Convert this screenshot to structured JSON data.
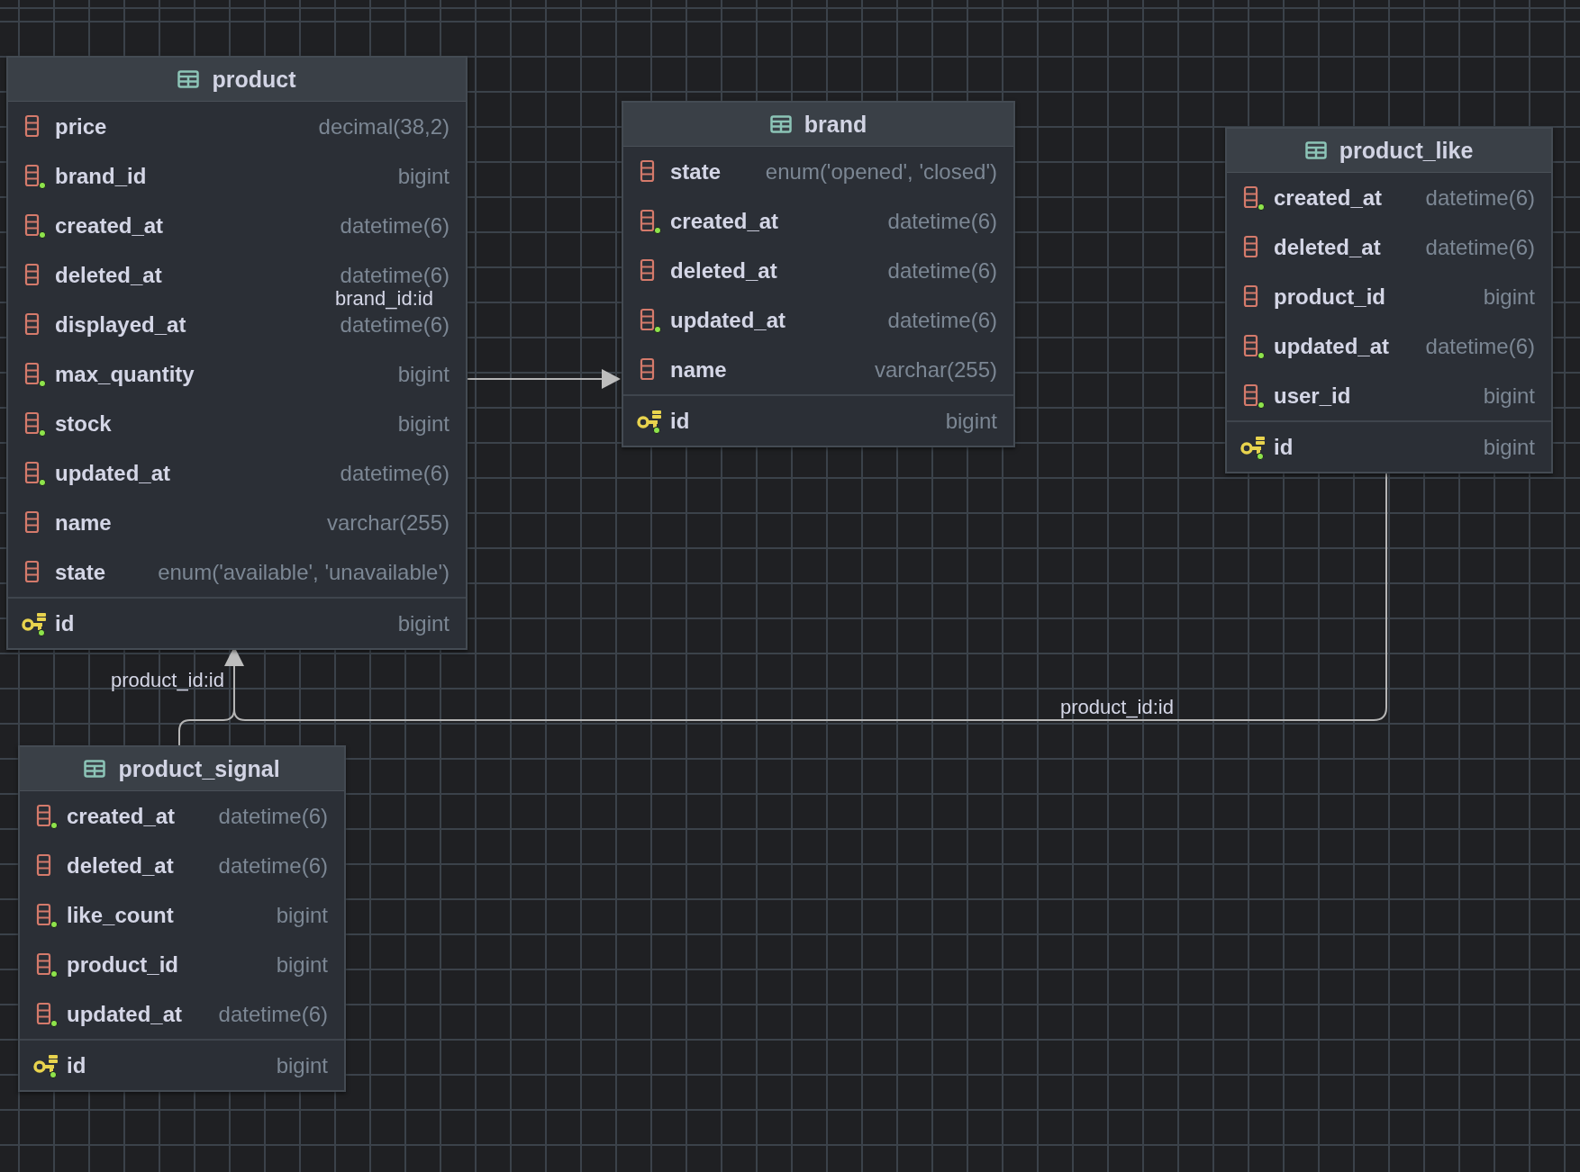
{
  "tables": [
    {
      "name": "product",
      "columns": [
        {
          "name": "price",
          "type": "decimal(38,2)",
          "kind": "column",
          "not_null": false
        },
        {
          "name": "brand_id",
          "type": "bigint",
          "kind": "column",
          "not_null": true
        },
        {
          "name": "created_at",
          "type": "datetime(6)",
          "kind": "column",
          "not_null": true
        },
        {
          "name": "deleted_at",
          "type": "datetime(6)",
          "kind": "column",
          "not_null": false
        },
        {
          "name": "displayed_at",
          "type": "datetime(6)",
          "kind": "column",
          "not_null": false
        },
        {
          "name": "max_quantity",
          "type": "bigint",
          "kind": "column",
          "not_null": true
        },
        {
          "name": "stock",
          "type": "bigint",
          "kind": "column",
          "not_null": true
        },
        {
          "name": "updated_at",
          "type": "datetime(6)",
          "kind": "column",
          "not_null": true
        },
        {
          "name": "name",
          "type": "varchar(255)",
          "kind": "column",
          "not_null": false
        },
        {
          "name": "state",
          "type": "enum('available', 'unavailable')",
          "kind": "column",
          "not_null": false
        },
        {
          "name": "id",
          "type": "bigint",
          "kind": "primary_key",
          "not_null": true
        }
      ]
    },
    {
      "name": "brand",
      "columns": [
        {
          "name": "state",
          "type": "enum('opened', 'closed')",
          "kind": "column",
          "not_null": false
        },
        {
          "name": "created_at",
          "type": "datetime(6)",
          "kind": "column",
          "not_null": true
        },
        {
          "name": "deleted_at",
          "type": "datetime(6)",
          "kind": "column",
          "not_null": false
        },
        {
          "name": "updated_at",
          "type": "datetime(6)",
          "kind": "column",
          "not_null": true
        },
        {
          "name": "name",
          "type": "varchar(255)",
          "kind": "column",
          "not_null": false
        },
        {
          "name": "id",
          "type": "bigint",
          "kind": "primary_key",
          "not_null": true
        }
      ]
    },
    {
      "name": "product_like",
      "columns": [
        {
          "name": "created_at",
          "type": "datetime(6)",
          "kind": "column",
          "not_null": true
        },
        {
          "name": "deleted_at",
          "type": "datetime(6)",
          "kind": "column",
          "not_null": false
        },
        {
          "name": "product_id",
          "type": "bigint",
          "kind": "column",
          "not_null": false
        },
        {
          "name": "updated_at",
          "type": "datetime(6)",
          "kind": "column",
          "not_null": true
        },
        {
          "name": "user_id",
          "type": "bigint",
          "kind": "column",
          "not_null": true
        },
        {
          "name": "id",
          "type": "bigint",
          "kind": "primary_key",
          "not_null": true
        }
      ]
    },
    {
      "name": "product_signal",
      "columns": [
        {
          "name": "created_at",
          "type": "datetime(6)",
          "kind": "column",
          "not_null": true
        },
        {
          "name": "deleted_at",
          "type": "datetime(6)",
          "kind": "column",
          "not_null": false
        },
        {
          "name": "like_count",
          "type": "bigint",
          "kind": "column",
          "not_null": true
        },
        {
          "name": "product_id",
          "type": "bigint",
          "kind": "column",
          "not_null": true
        },
        {
          "name": "updated_at",
          "type": "datetime(6)",
          "kind": "column",
          "not_null": true
        },
        {
          "name": "id",
          "type": "bigint",
          "kind": "primary_key",
          "not_null": true
        }
      ]
    }
  ],
  "relations": [
    {
      "label": "brand_id:id"
    },
    {
      "label": "product_id:id"
    },
    {
      "label": "product_id:id"
    }
  ]
}
